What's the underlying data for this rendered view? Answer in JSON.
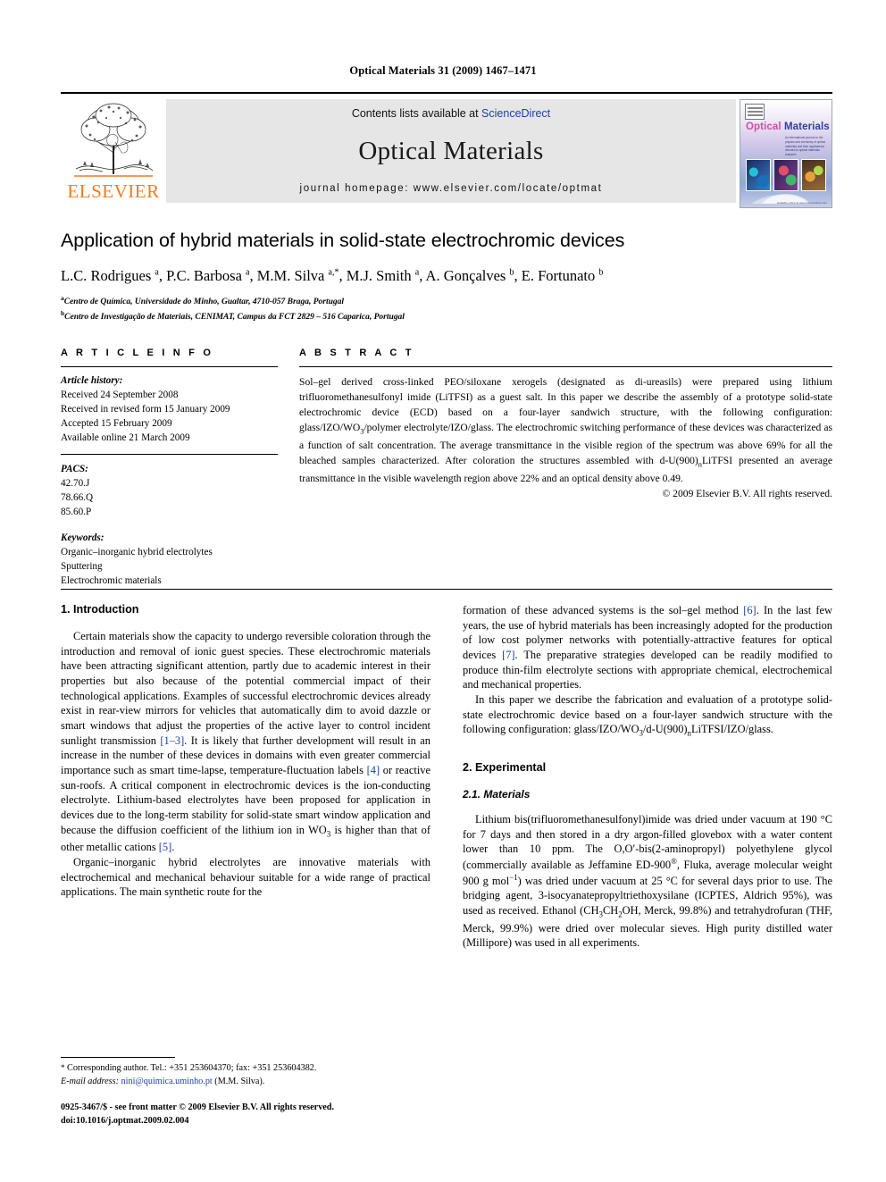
{
  "running_head": "Optical Materials 31 (2009) 1467–1471",
  "masthead": {
    "publisher_name": "ELSEVIER",
    "contents_prefix": "Contents lists available at ",
    "sciencedirect": "ScienceDirect",
    "journal_title": "Optical Materials",
    "homepage": "journal homepage: www.elsevier.com/locate/optmat",
    "cover": {
      "title_part1": "Optical ",
      "title_part2": "Materials",
      "subtitle": "An international journal on the physics and chemistry of optical materials and their applications devoted to optical materials research",
      "footer": "Available online at www.sciencedirect.com"
    },
    "colors": {
      "band_bg": "#e6e6e6",
      "elsevier_orange": "#ef7d22",
      "link_blue": "#1a3fa8"
    }
  },
  "article": {
    "title": "Application of hybrid materials in solid-state electrochromic devices",
    "authors_html": "L.C. Rodrigues <sup>a</sup>, P.C. Barbosa <sup>a</sup>, M.M. Silva <sup>a,</sup><sup>*</sup>, M.J. Smith <sup>a</sup>, A. Gonçalves <sup>b</sup>, E. Fortunato <sup>b</sup>",
    "affiliations": [
      {
        "marker": "a",
        "text": "Centro de Química, Universidade do Minho, Gualtar, 4710-057 Braga, Portugal"
      },
      {
        "marker": "b",
        "text": "Centro de Investigação de Materiais, CENIMAT, Campus da FCT 2829 – 516 Caparica, Portugal"
      }
    ]
  },
  "article_info": {
    "heading": "A R T I C L E  I N F O",
    "history_label": "Article history:",
    "history": [
      "Received 24 September 2008",
      "Received in revised form 15 January 2009",
      "Accepted 15 February 2009",
      "Available online 21 March 2009"
    ],
    "pacs_label": "PACS:",
    "pacs": [
      "42.70.J",
      "78.66.Q",
      "85.60.P"
    ],
    "keywords_label": "Keywords:",
    "keywords": [
      "Organic–inorganic hybrid electrolytes",
      "Sputtering",
      "Electrochromic materials"
    ]
  },
  "abstract": {
    "heading": "A B S T R A C T",
    "body_html": "Sol–gel derived cross-linked PEO/siloxane xerogels (designated as di-ureasils) were prepared using lithium trifluoromethanesulfonyl imide (LiTFSI) as a guest salt. In this paper we describe the assembly of a prototype solid-state electrochromic device (ECD) based on a four-layer sandwich structure, with the following configuration: glass/IZO/WO<sub>3</sub>/polymer electrolyte/IZO/glass. The electrochromic switching performance of these devices was characterized as a function of salt concentration. The average transmittance in the visible region of the spectrum was above 69% for all the bleached samples characterized. After coloration the structures assembled with d-U(900)<sub>n</sub>LiTFSI presented an average transmittance in the visible wavelength region above 22% and an optical density above 0.49.",
    "copyright": "© 2009 Elsevier B.V. All rights reserved."
  },
  "sections": {
    "introduction": {
      "heading": "1. Introduction",
      "paragraphs_html": [
        "Certain materials show the capacity to undergo reversible coloration through the introduction and removal of ionic guest species. These electrochromic materials have been attracting significant attention, partly due to academic interest in their properties but also because of the potential commercial impact of their technological applications. Examples of successful electrochromic devices already exist in rear-view mirrors for vehicles that automatically dim to avoid dazzle or smart windows that adjust the properties of the active layer to control incident sunlight transmission <span class=\"ref\">[1–3]</span>. It is likely that further development will result in an increase in the number of these devices in domains with even greater commercial importance such as smart time-lapse, temperature-fluctuation labels <span class=\"ref\">[4]</span> or reactive sun-roofs. A critical component in electrochromic devices is the ion-conducting electrolyte. Lithium-based electrolytes have been proposed for application in devices due to the long-term stability for solid-state smart window application and because the diffusion coefficient of the lithium ion in WO<sub>3</sub> is higher than that of other metallic cations <span class=\"ref\">[5]</span>.",
        "Organic–inorganic hybrid electrolytes are innovative materials with electrochemical and mechanical behaviour suitable for a wide range of practical applications. The main synthetic route for the formation of these advanced systems is the sol–gel method <span class=\"ref\">[6]</span>. In the last few years, the use of hybrid materials has been increasingly adopted for the production of low cost polymer networks with potentially-attractive features for optical devices <span class=\"ref\">[7]</span>. The preparative strategies developed can be readily modified to produce thin-film electrolyte sections with appropriate chemical, electrochemical and mechanical properties.",
        "In this paper we describe the fabrication and evaluation of a prototype solid-state electrochromic device based on a four-layer sandwich structure with the following configuration: glass/IZO/WO<sub>3</sub>/d-U(900)<sub>n</sub>LiTFSI/IZO/glass."
      ]
    },
    "experimental": {
      "heading": "2. Experimental",
      "subsection_heading": "2.1. Materials",
      "paragraphs_html": [
        "Lithium bis(trifluoromethanesulfonyl)imide was dried under vacuum at 190 °C for 7 days and then stored in a dry argon-filled glovebox with a water content lower than 10 ppm. The O,O′-bis(2-aminopropyl) polyethylene glycol (commercially available as Jeffamine ED-900<sup>®</sup>, Fluka, average molecular weight 900 g mol<sup>−1</sup>) was dried under vacuum at 25 °C for several days prior to use. The bridging agent, 3-isocyanatepropyltriethoxysilane (ICPTES, Aldrich 95%), was used as received. Ethanol (CH<sub>3</sub>CH<sub>2</sub>OH, Merck, 99.8%) and tetrahydrofuran (THF, Merck, 99.9%) were dried over molecular sieves. High purity distilled water (Millipore) was used in all experiments."
      ]
    }
  },
  "footnote": {
    "star": "*",
    "line1": "Corresponding author. Tel.: +351 253604370; fax: +351 253604382.",
    "email_label": "E-mail address:",
    "email": "nini@quimica.uminho.pt",
    "email_owner": "(M.M. Silva)."
  },
  "page_footer": {
    "line1": "0925-3467/$ - see front matter © 2009 Elsevier B.V. All rights reserved.",
    "line2": "doi:10.1016/j.optmat.2009.02.004"
  }
}
